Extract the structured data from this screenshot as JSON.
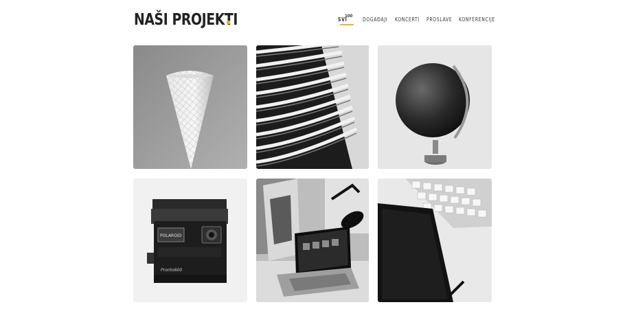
{
  "header": {
    "title": "NAŠI PROJEKTI",
    "accent_color": "#f3b51b"
  },
  "nav": {
    "items": [
      {
        "label": "SVI",
        "count": "100",
        "active": true
      },
      {
        "label": "DOGAĐAJI",
        "active": false
      },
      {
        "label": "KONCERTI",
        "active": false
      },
      {
        "label": "PROSLAVE",
        "active": false
      },
      {
        "label": "KONFERENCIJE",
        "active": false
      }
    ]
  },
  "gallery": {
    "items": [
      {
        "name": "ice-cream-cone-photo"
      },
      {
        "name": "building-facade-photo"
      },
      {
        "name": "globe-photo"
      },
      {
        "name": "polaroid-camera-photo",
        "text_lines": [
          "POLAROID",
          "Pronto600"
        ]
      },
      {
        "name": "laptop-desk-lamp-photo"
      },
      {
        "name": "tablet-keyboard-photo"
      }
    ]
  }
}
